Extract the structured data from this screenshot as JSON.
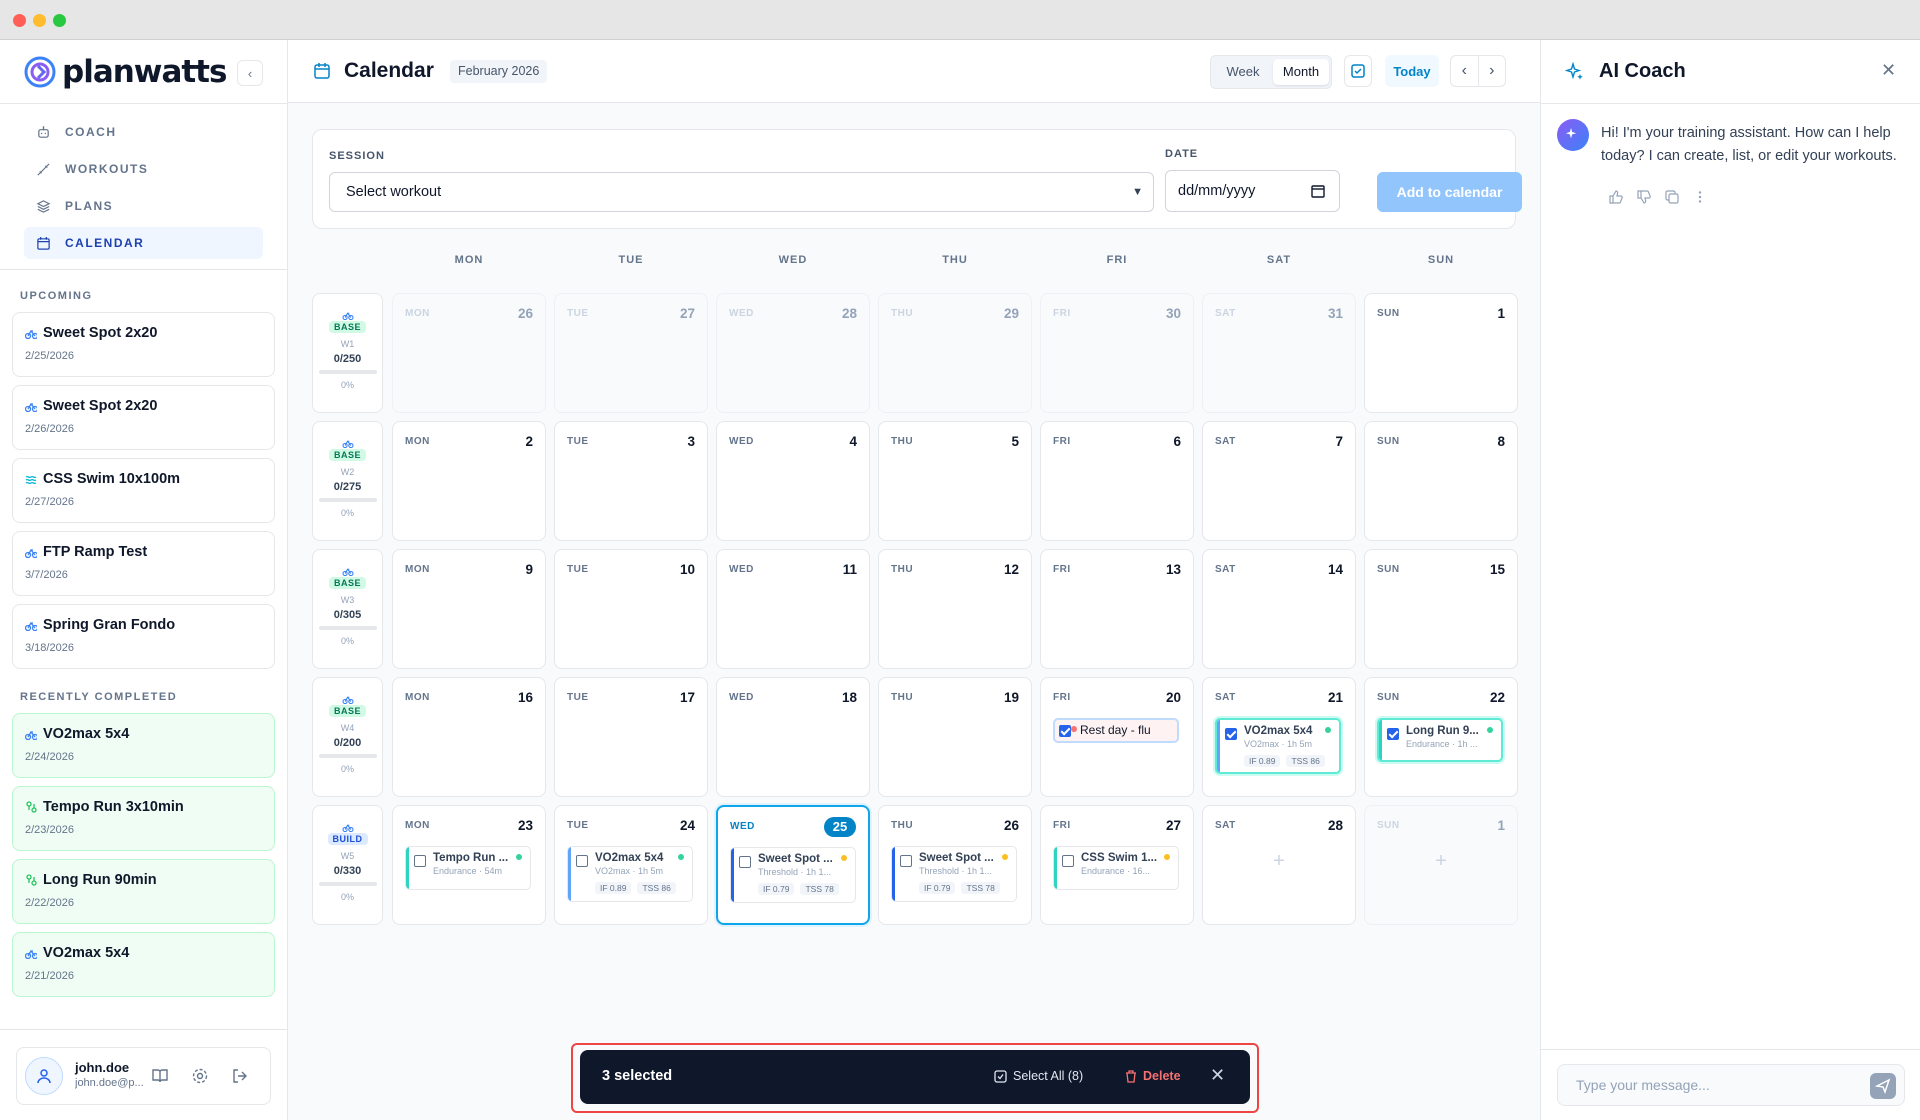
{
  "window": {
    "traffic": [
      "#ff5f57",
      "#febc2e",
      "#28c840"
    ]
  },
  "brand": {
    "name": "planwatts"
  },
  "nav": [
    {
      "label": "COACH",
      "icon": "robot-icon"
    },
    {
      "label": "WORKOUTS",
      "icon": "workout-icon"
    },
    {
      "label": "PLANS",
      "icon": "layers-icon"
    },
    {
      "label": "CALENDAR",
      "icon": "calendar-icon",
      "active": true
    }
  ],
  "upcoming": {
    "label": "UPCOMING",
    "items": [
      {
        "title": "Sweet Spot 2x20",
        "date": "2/25/2026",
        "sport": "bike"
      },
      {
        "title": "Sweet Spot 2x20",
        "date": "2/26/2026",
        "sport": "bike"
      },
      {
        "title": "CSS Swim 10x100m",
        "date": "2/27/2026",
        "sport": "swim"
      },
      {
        "title": "FTP Ramp Test",
        "date": "3/7/2026",
        "sport": "bike"
      },
      {
        "title": "Spring Gran Fondo",
        "date": "3/18/2026",
        "sport": "bike"
      }
    ]
  },
  "completed": {
    "label": "RECENTLY COMPLETED",
    "items": [
      {
        "title": "VO2max 5x4",
        "date": "2/24/2026",
        "sport": "bike"
      },
      {
        "title": "Tempo Run 3x10min",
        "date": "2/23/2026",
        "sport": "run"
      },
      {
        "title": "Long Run 90min",
        "date": "2/22/2026",
        "sport": "run"
      },
      {
        "title": "VO2max 5x4",
        "date": "2/21/2026",
        "sport": "bike"
      }
    ]
  },
  "user": {
    "name": "john.doe",
    "email": "john.doe@p..."
  },
  "header": {
    "title": "Calendar",
    "period": "February 2026",
    "view_week": "Week",
    "view_month": "Month",
    "active_view": "Month",
    "today": "Today"
  },
  "session": {
    "session_label": "SESSION",
    "select_value": "Select workout",
    "date_label": "DATE",
    "date_placeholder": "dd/mm/yyyy",
    "add_label": "Add to calendar"
  },
  "weekdays": [
    "MON",
    "TUE",
    "WED",
    "THU",
    "FRI",
    "SAT",
    "SUN"
  ],
  "weeks": [
    {
      "phase": "BASE",
      "w": "W1",
      "load": "0/250",
      "pct": "0%",
      "progress": 0,
      "days": [
        {
          "dow": "MON",
          "num": "26",
          "out": true
        },
        {
          "dow": "TUE",
          "num": "27",
          "out": true
        },
        {
          "dow": "WED",
          "num": "28",
          "out": true
        },
        {
          "dow": "THU",
          "num": "29",
          "out": true
        },
        {
          "dow": "FRI",
          "num": "30",
          "out": true
        },
        {
          "dow": "SAT",
          "num": "31",
          "out": true
        },
        {
          "dow": "SUN",
          "num": "1"
        }
      ]
    },
    {
      "phase": "BASE",
      "w": "W2",
      "load": "0/275",
      "pct": "0%",
      "progress": 0,
      "days": [
        {
          "dow": "MON",
          "num": "2"
        },
        {
          "dow": "TUE",
          "num": "3"
        },
        {
          "dow": "WED",
          "num": "4"
        },
        {
          "dow": "THU",
          "num": "5"
        },
        {
          "dow": "FRI",
          "num": "6"
        },
        {
          "dow": "SAT",
          "num": "7"
        },
        {
          "dow": "SUN",
          "num": "8"
        }
      ]
    },
    {
      "phase": "BASE",
      "w": "W3",
      "load": "0/305",
      "pct": "0%",
      "progress": 0,
      "days": [
        {
          "dow": "MON",
          "num": "9"
        },
        {
          "dow": "TUE",
          "num": "10"
        },
        {
          "dow": "WED",
          "num": "11"
        },
        {
          "dow": "THU",
          "num": "12"
        },
        {
          "dow": "FRI",
          "num": "13"
        },
        {
          "dow": "SAT",
          "num": "14"
        },
        {
          "dow": "SUN",
          "num": "15"
        }
      ]
    },
    {
      "phase": "BASE",
      "w": "W4",
      "load": "0/200",
      "pct": "0%",
      "progress": 0,
      "days": [
        {
          "dow": "MON",
          "num": "16"
        },
        {
          "dow": "TUE",
          "num": "17"
        },
        {
          "dow": "WED",
          "num": "18"
        },
        {
          "dow": "THU",
          "num": "19"
        },
        {
          "dow": "FRI",
          "num": "20",
          "event": {
            "title": "Rest day - flu",
            "kind": "rest",
            "checked": true
          }
        },
        {
          "dow": "SAT",
          "num": "21",
          "event": {
            "title": "VO2max 5x4",
            "sub": "VO2max · 1h 5m",
            "if": "IF 0.89",
            "tss": "TSS 86",
            "bar": "#60a5fa",
            "dot": "#34d399",
            "checked": true,
            "selected": true
          }
        },
        {
          "dow": "SUN",
          "num": "22",
          "event": {
            "title": "Long Run 9...",
            "sub": "Endurance · 1h ...",
            "bar": "#2dd4bf",
            "dot": "#34d399",
            "checked": true,
            "selected": true
          }
        }
      ]
    },
    {
      "phase": "BUILD",
      "w": "W5",
      "load": "0/330",
      "pct": "0%",
      "progress": 0,
      "days": [
        {
          "dow": "MON",
          "num": "23",
          "event": {
            "title": "Tempo Run ...",
            "sub": "Endurance · 54m",
            "bar": "#2dd4bf",
            "dot": "#34d399"
          }
        },
        {
          "dow": "TUE",
          "num": "24",
          "event": {
            "title": "VO2max 5x4",
            "sub": "VO2max · 1h 5m",
            "if": "IF 0.89",
            "tss": "TSS 86",
            "bar": "#60a5fa",
            "dot": "#34d399"
          }
        },
        {
          "dow": "WED",
          "num": "25",
          "today": true,
          "event": {
            "title": "Sweet Spot ...",
            "sub": "Threshold · 1h 1...",
            "if": "IF 0.79",
            "tss": "TSS 78",
            "bar": "#2563eb",
            "dot": "#fbbf24"
          }
        },
        {
          "dow": "THU",
          "num": "26",
          "event": {
            "title": "Sweet Spot ...",
            "sub": "Threshold · 1h 1...",
            "if": "IF 0.79",
            "tss": "TSS 78",
            "bar": "#2563eb",
            "dot": "#fbbf24"
          }
        },
        {
          "dow": "FRI",
          "num": "27",
          "event": {
            "title": "CSS Swim 1...",
            "sub": "Endurance · 16...",
            "bar": "#2dd4bf",
            "dot": "#fbbf24"
          }
        },
        {
          "dow": "SAT",
          "num": "28",
          "plus": true
        },
        {
          "dow": "SUN",
          "num": "1",
          "out": true,
          "plus": true
        }
      ]
    }
  ],
  "actionbar": {
    "count": "3 selected",
    "select_all": "Select All (8)",
    "delete": "Delete"
  },
  "coach": {
    "title": "AI Coach",
    "message": "Hi! I'm your training assistant. How can I help today? I can create, list, or edit your workouts.",
    "placeholder": "Type your message..."
  }
}
